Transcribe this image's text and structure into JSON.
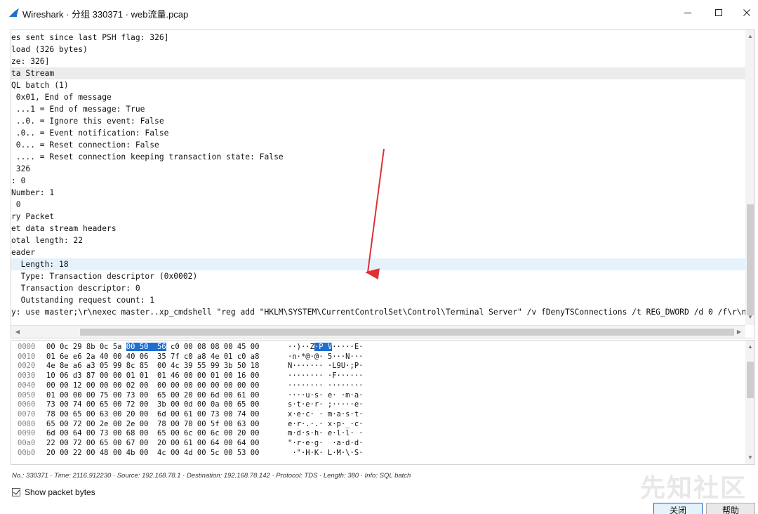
{
  "window": {
    "title": "Wireshark · 分组 330371 · web流量.pcap",
    "logo_icon": "wireshark-fin-icon",
    "accent": "#1f6fd1"
  },
  "details": {
    "lines": [
      "es sent since last PSH flag: 326]",
      "load (326 bytes)",
      "ze: 326]",
      "ta Stream",
      "QL batch (1)",
      " 0x01, End of message",
      " ...1 = End of message: True",
      " ..0. = Ignore this event: False",
      " .0.. = Event notification: False",
      " 0... = Reset connection: False",
      " .... = Reset connection keeping transaction state: False",
      " 326",
      ": 0",
      "Number: 1",
      " 0",
      "ry Packet",
      "et data stream headers",
      "otal length: 22",
      "eader",
      "  Length: 18",
      "  Type: Transaction descriptor (0x0002)",
      "  Transaction descriptor: 0",
      "  Outstanding request count: 1",
      "y: use master;\\r\\nexec master..xp_cmdshell \"reg add \"HKLM\\SYSTEM\\CurrentControlSet\\Control\\Terminal Server\" /v fDenyTSConnections /t REG_DWORD /d 0 /f\\r\\n\""
    ]
  },
  "bytes": {
    "rows": [
      {
        "offset": "0000",
        "hex_pre": "00 0c 29 8b 0c 5a ",
        "hex_hl": "00 50  56",
        "hex_post": " c0 00 08 08 00 45 00",
        "ascii_pre": "··)··Z",
        "ascii_hl": "·P V",
        "ascii_post": "·····E·"
      },
      {
        "offset": "0010",
        "hex_pre": "01 6e e6 2a 40 00 40 06  35 7f c0 a8 4e 01 c0 a8",
        "hex_hl": "",
        "hex_post": "",
        "ascii_pre": "·n·*@·@· 5···N···",
        "ascii_hl": "",
        "ascii_post": ""
      },
      {
        "offset": "0020",
        "hex_pre": "4e 8e a6 a3 05 99 8c 85  00 4c 39 55 99 3b 50 18",
        "hex_hl": "",
        "hex_post": "",
        "ascii_pre": "N······· ·L9U·;P·",
        "ascii_hl": "",
        "ascii_post": ""
      },
      {
        "offset": "0030",
        "hex_pre": "10 06 d3 87 00 00 01 01  01 46 00 00 01 00 16 00",
        "hex_hl": "",
        "hex_post": "",
        "ascii_pre": "········ ·F······",
        "ascii_hl": "",
        "ascii_post": ""
      },
      {
        "offset": "0040",
        "hex_pre": "00 00 12 00 00 00 02 00  00 00 00 00 00 00 00 00",
        "hex_hl": "",
        "hex_post": "",
        "ascii_pre": "········ ········",
        "ascii_hl": "",
        "ascii_post": ""
      },
      {
        "offset": "0050",
        "hex_pre": "01 00 00 00 75 00 73 00  65 00 20 00 6d 00 61 00",
        "hex_hl": "",
        "hex_post": "",
        "ascii_pre": "····u·s· e· ·m·a·",
        "ascii_hl": "",
        "ascii_post": ""
      },
      {
        "offset": "0060",
        "hex_pre": "73 00 74 00 65 00 72 00  3b 00 0d 00 0a 00 65 00",
        "hex_hl": "",
        "hex_post": "",
        "ascii_pre": "s·t·e·r· ;·····e·",
        "ascii_hl": "",
        "ascii_post": ""
      },
      {
        "offset": "0070",
        "hex_pre": "78 00 65 00 63 00 20 00  6d 00 61 00 73 00 74 00",
        "hex_hl": "",
        "hex_post": "",
        "ascii_pre": "x·e·c· · m·a·s·t·",
        "ascii_hl": "",
        "ascii_post": ""
      },
      {
        "offset": "0080",
        "hex_pre": "65 00 72 00 2e 00 2e 00  78 00 70 00 5f 00 63 00",
        "hex_hl": "",
        "hex_post": "",
        "ascii_pre": "e·r·.·.· x·p·_·c·",
        "ascii_hl": "",
        "ascii_post": ""
      },
      {
        "offset": "0090",
        "hex_pre": "6d 00 64 00 73 00 68 00  65 00 6c 00 6c 00 20 00",
        "hex_hl": "",
        "hex_post": "",
        "ascii_pre": "m·d·s·h· e·l·l· ·",
        "ascii_hl": "",
        "ascii_post": ""
      },
      {
        "offset": "00a0",
        "hex_pre": "22 00 72 00 65 00 67 00  20 00 61 00 64 00 64 00",
        "hex_hl": "",
        "hex_post": "",
        "ascii_pre": "\"·r·e·g·  ·a·d·d·",
        "ascii_hl": "",
        "ascii_post": ""
      },
      {
        "offset": "00b0",
        "hex_pre": "20 00 22 00 48 00 4b 00  4c 00 4d 00 5c 00 53 00",
        "hex_hl": "",
        "hex_post": "",
        "ascii_pre": " ·\"·H·K· L·M·\\·S·",
        "ascii_hl": "",
        "ascii_post": ""
      }
    ]
  },
  "status": {
    "text": "No.: 330371 · Time: 2116.912230 · Source: 192.168.78.1 · Destination: 192.168.78.142 · Protocol: TDS · Length: 380 · Info: SQL batch"
  },
  "options": {
    "show_packet_bytes_label": "Show packet bytes",
    "show_packet_bytes_checked": true
  },
  "buttons": {
    "close_label": "关闭",
    "help_label": "帮助"
  },
  "watermark": {
    "text": "先知社区"
  }
}
